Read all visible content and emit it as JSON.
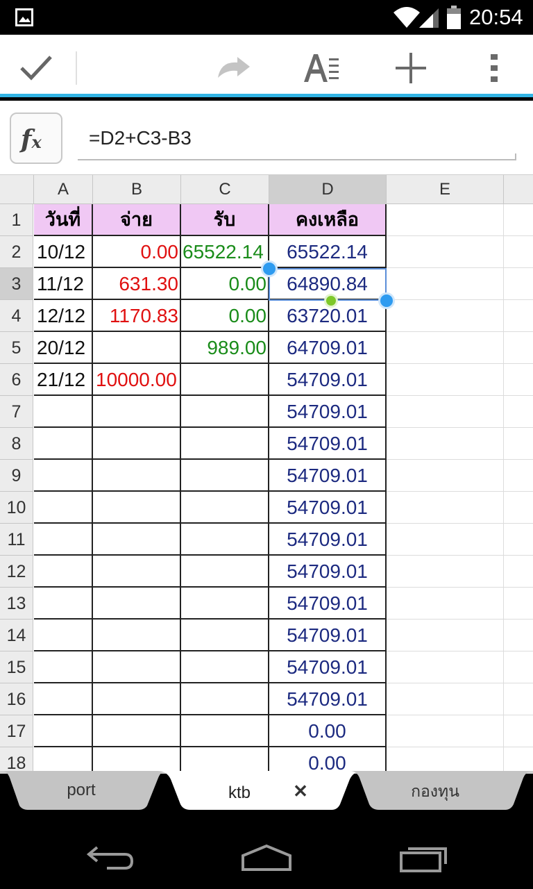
{
  "status_bar": {
    "time": "20:54",
    "icons": [
      "picture-icon",
      "wifi-icon",
      "signal-icon",
      "battery-icon"
    ]
  },
  "toolbar": {
    "buttons": [
      "check-icon",
      "redo-icon",
      "text-format-icon",
      "add-icon",
      "more-icon"
    ]
  },
  "formula_bar": {
    "fx_main": "f",
    "fx_sub": "x",
    "value": "=D2+C3-B3"
  },
  "sheet": {
    "columns": [
      "A",
      "B",
      "C",
      "D",
      "E"
    ],
    "selected_column": "D",
    "selected_row": "3",
    "header_row": {
      "row": "1",
      "cells": [
        "วันที่",
        "จ่าย",
        "รับ",
        "คงเหลือ"
      ]
    },
    "rows": [
      {
        "row": "2",
        "a": "10/12",
        "b": "0.00",
        "c": "65522.14",
        "d": "65522.14"
      },
      {
        "row": "3",
        "a": "11/12",
        "b": "631.30",
        "c": "0.00",
        "d": "64890.84"
      },
      {
        "row": "4",
        "a": "12/12",
        "b": "1170.83",
        "c": "0.00",
        "d": "63720.01"
      },
      {
        "row": "5",
        "a": "20/12",
        "b": "",
        "c": "989.00",
        "d": "64709.01"
      },
      {
        "row": "6",
        "a": "21/12",
        "b": "10000.00",
        "c": "",
        "d": "54709.01"
      },
      {
        "row": "7",
        "a": "",
        "b": "",
        "c": "",
        "d": "54709.01"
      },
      {
        "row": "8",
        "a": "",
        "b": "",
        "c": "",
        "d": "54709.01"
      },
      {
        "row": "9",
        "a": "",
        "b": "",
        "c": "",
        "d": "54709.01"
      },
      {
        "row": "10",
        "a": "",
        "b": "",
        "c": "",
        "d": "54709.01"
      },
      {
        "row": "11",
        "a": "",
        "b": "",
        "c": "",
        "d": "54709.01"
      },
      {
        "row": "12",
        "a": "",
        "b": "",
        "c": "",
        "d": "54709.01"
      },
      {
        "row": "13",
        "a": "",
        "b": "",
        "c": "",
        "d": "54709.01"
      },
      {
        "row": "14",
        "a": "",
        "b": "",
        "c": "",
        "d": "54709.01"
      },
      {
        "row": "15",
        "a": "",
        "b": "",
        "c": "",
        "d": "54709.01"
      },
      {
        "row": "16",
        "a": "",
        "b": "",
        "c": "",
        "d": "54709.01"
      },
      {
        "row": "17",
        "a": "",
        "b": "",
        "c": "",
        "d": "0.00"
      },
      {
        "row": "18",
        "a": "",
        "b": "",
        "c": "",
        "d": "0.00"
      }
    ],
    "colors": {
      "header_fill": "#f0c8f4",
      "expense": "#e01010",
      "income": "#1a8c1a",
      "balance": "#1c2a80",
      "selection": "#2e9bf0"
    }
  },
  "sheet_tabs": {
    "tabs": [
      "port",
      "ktb",
      "กองทุน"
    ],
    "active": "ktb",
    "close_glyph": "✕"
  },
  "nav_bar": {
    "buttons": [
      "back-icon",
      "home-icon",
      "recents-icon"
    ]
  }
}
